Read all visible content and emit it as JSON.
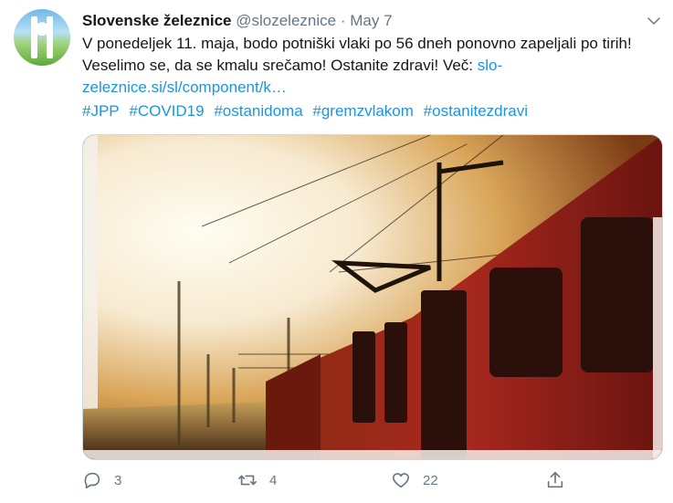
{
  "tweet": {
    "author_name": "Slovenske železnice",
    "handle": "@slozeleznice",
    "separator": "·",
    "date": "May 7",
    "text_main": "V ponedeljek 11. maja, bodo potniški vlaki po 56 dneh ponovno zapeljali po tirih! Veselimo se, da se kmalu srečamo! Ostanite zdravi! Več: ",
    "link_text": "slo-zeleznice.si/sl/component/k…",
    "hashtags": [
      "#JPP",
      "#COVID19",
      "#ostanidoma",
      "#gremzvlakom",
      "#ostanitezdravi"
    ]
  },
  "actions": {
    "replies": "3",
    "retweets": "4",
    "likes": "22"
  },
  "icons": {
    "menu": "chevron-down-icon",
    "reply": "reply-icon",
    "retweet": "retweet-icon",
    "like": "heart-icon",
    "share": "share-icon"
  },
  "colors": {
    "link": "#1b95e0",
    "muted": "#657786",
    "text": "#14171a"
  }
}
